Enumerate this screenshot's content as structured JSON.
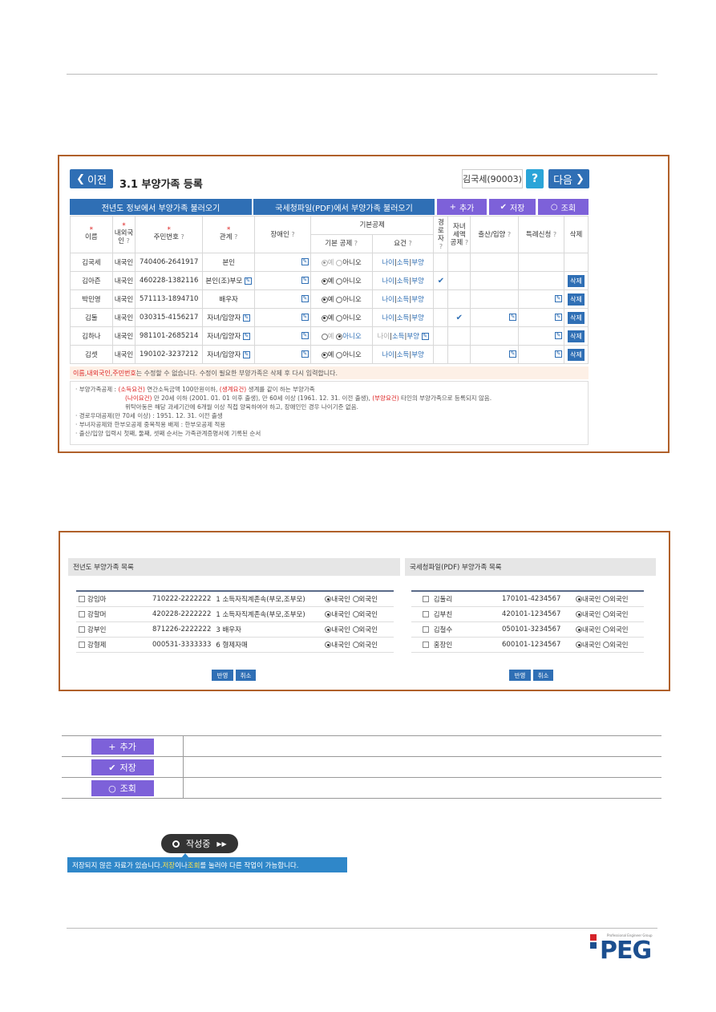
{
  "panel1": {
    "prev_label": "이전",
    "title": "3.1  부양가족 등록",
    "user": "김국세(90003)",
    "help": "?",
    "next_label": "다음",
    "bar_prev_year": "전년도 정보에서 부양가족 불러오기",
    "bar_pdf": "국세청파일(PDF)에서 부양가족 불러오기",
    "bar_add": "추가",
    "bar_save": "저장",
    "bar_query": "조회",
    "headers": {
      "name": "이름",
      "nat": "내외국인",
      "rrn": "주민번호",
      "rel": "관계",
      "disabled": "장애인",
      "basic": "기본공제",
      "basic_sub": "기본 공제",
      "req": "요건",
      "senior": "경로자",
      "child": "자녀세액공제",
      "birth": "출산/입양",
      "special": "특례신청",
      "delete": "삭제"
    },
    "yes": "예",
    "no": "아니오",
    "age": "나이",
    "income": "소득",
    "support": "부양",
    "del_label": "삭제",
    "rows": [
      {
        "name": "김국세",
        "nat": "내국인",
        "rrn": "740406-2641917",
        "rel": "본인"
      },
      {
        "name": "김아즌",
        "nat": "내국인",
        "rrn": "460228-1382116",
        "rel": "본인(조)부모"
      },
      {
        "name": "박민영",
        "nat": "내국인",
        "rrn": "571113-1894710",
        "rel": "배우자"
      },
      {
        "name": "김둘",
        "nat": "내국인",
        "rrn": "030315-4156217",
        "rel": "자녀/입양자"
      },
      {
        "name": "김하나",
        "nat": "내국인",
        "rrn": "981101-2685214",
        "rel": "자녀/입양자"
      },
      {
        "name": "김셋",
        "nat": "내국인",
        "rrn": "190102-3237212",
        "rel": "자녀/입양자"
      }
    ],
    "notice_red1": "이름",
    "notice_sep1": ", ",
    "notice_red2": "내외국인",
    "notice_sep2": ", ",
    "notice_red3": "주민번호",
    "notice_rest": "는 수정할 수 없습니다. 수정이 필요한 부양가족은 삭제 후 다시 입력합니다.",
    "n1_a": "· 부양가족공제 : ",
    "n1_b": "(소득요건)",
    "n1_c": " 연간소득금액 100만원이하, ",
    "n1_d": "(생계요건)",
    "n1_e": " 생계를 같이 하는 부양가족",
    "n2_a": "(나이요건)",
    "n2_b": " 만 20세 이하 (2001. 01. 01 이후 출생), 만 60세 이상 (1961. 12. 31. 이전 출생), ",
    "n2_c": "(부양요건)",
    "n2_d": " 타인의 부양가족으로 등록되지 않음.",
    "n3": "위탁아동은 해당 과세기간에 6개월 이상 직접 양육하여야 하고, 장애인인 경우 나이기준 없음.",
    "n4": "· 경로우대공제(만 70세 이상) : 1951. 12. 31. 이전 출생",
    "n5": "· 부녀자공제와 한부모공제 중복적용 배제 : 한부모공제 적용",
    "n6": "· 출산/입양 입력시 첫째, 둘째, 셋째 순서는 가족관계증명서에 기록된 순서"
  },
  "panel2": {
    "left_title": "전년도 부양가족 목록",
    "right_title": "국세청파일(PDF) 부양가족 목록",
    "domestic": "내국인",
    "foreign": "외국인",
    "apply": "반영",
    "cancel": "취소",
    "left_rows": [
      {
        "name": "강임마",
        "rrn": "710222-2222222",
        "rel": "1 소득자직계존속(부모,조부모)"
      },
      {
        "name": "강할머",
        "rrn": "420228-2222222",
        "rel": "1 소득자직계존속(부모,조부모)"
      },
      {
        "name": "강부인",
        "rrn": "871226-2222222",
        "rel": "3 배우자"
      },
      {
        "name": "강형제",
        "rrn": "000531-3333333",
        "rel": "6 형제자매"
      }
    ],
    "right_rows": [
      {
        "name": "김둘리",
        "rrn": "170101-4234567"
      },
      {
        "name": "김부친",
        "rrn": "420101-1234567"
      },
      {
        "name": "김철수",
        "rrn": "050101-3234567"
      },
      {
        "name": "홍장인",
        "rrn": "600101-1234567"
      }
    ]
  },
  "legend": [
    {
      "label": "추가",
      "icon": "plus-icon"
    },
    {
      "label": "저장",
      "icon": "check-icon"
    },
    {
      "label": "조회",
      "icon": "circle-icon"
    }
  ],
  "badge": {
    "label": "작성중",
    "tip_a": "저장되지 않은 자료가 있습니다. ",
    "tip_b": "저장",
    "tip_c": "이나 ",
    "tip_d": "조회",
    "tip_e": "를 눌러야 다른 작업이 가능합니다."
  },
  "logo": {
    "tagline": "Professional Engineer Group",
    "text": "PEG"
  }
}
